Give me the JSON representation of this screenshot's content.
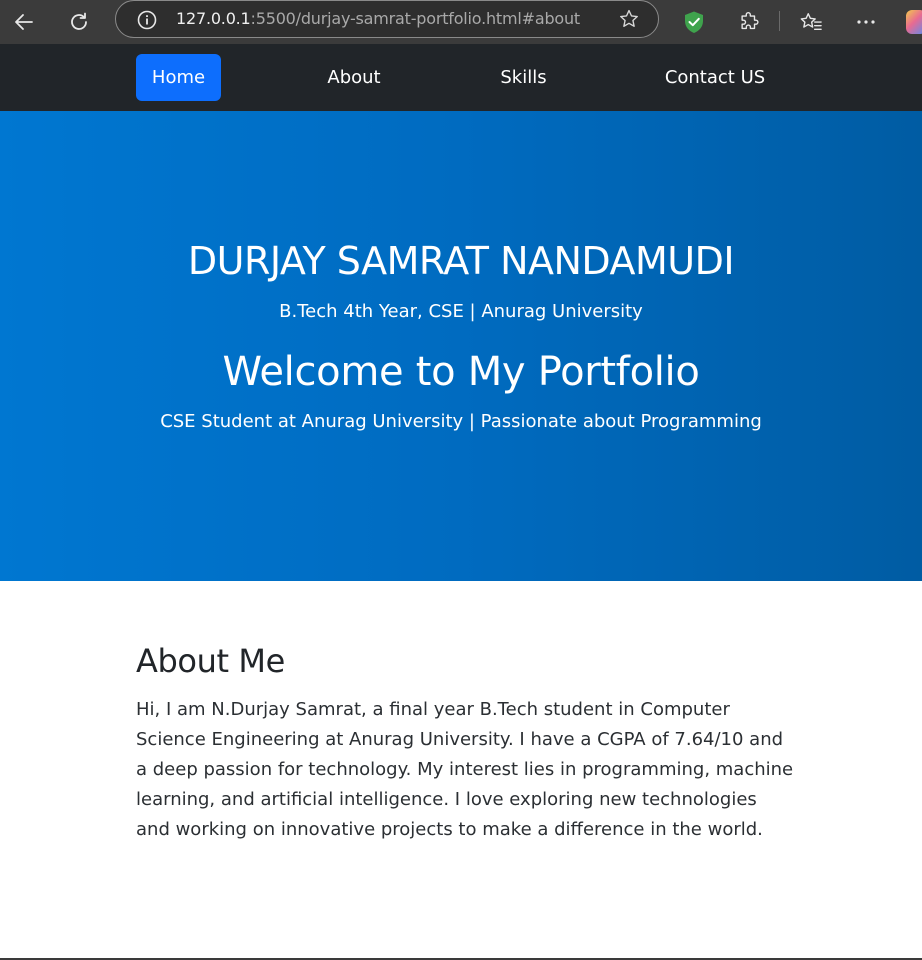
{
  "browser": {
    "url_host": "127.0.0.1",
    "url_rest": ":5500/durjay-samrat-portfolio.html#about"
  },
  "nav": {
    "items": [
      {
        "label": "Home",
        "active": true
      },
      {
        "label": "About"
      },
      {
        "label": "Skills"
      },
      {
        "label": "Contact US"
      }
    ]
  },
  "hero": {
    "name": "DURJAY SAMRAT NANDAMUDI",
    "degree": "B.Tech 4th Year, CSE | Anurag University",
    "welcome": "Welcome to My Portfolio",
    "tagline": "CSE Student at Anurag University | Passionate about Programming"
  },
  "about": {
    "title": "About Me",
    "text": "Hi, I am N.Durjay Samrat, a final year B.Tech student in Computer Science Engineering at Anurag University. I have a CGPA of 7.64/10 and a deep passion for technology. My interest lies in programming, machine learning, and artificial intelligence. I love exploring new technologies and working on innovative projects to make a difference in the world."
  },
  "colors": {
    "navbar_bg": "#212529",
    "active_nav": "#0d6efd",
    "hero_gradient_start": "#0077d1",
    "hero_gradient_end": "#005ca3"
  },
  "icons": [
    "back-arrow-icon",
    "reload-icon",
    "info-icon",
    "star-icon",
    "shield-icon",
    "extensions-icon",
    "favorites-icon",
    "more-icon"
  ]
}
